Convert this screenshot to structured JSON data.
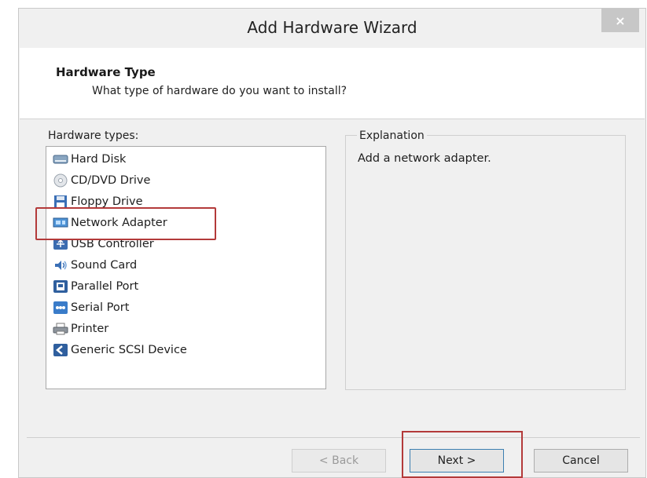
{
  "window": {
    "title": "Add Hardware Wizard",
    "close_label": "×"
  },
  "header": {
    "heading": "Hardware Type",
    "subheading": "What type of hardware do you want to install?"
  },
  "hardware_list": {
    "label": "Hardware types:",
    "selected": "Network Adapter",
    "items": [
      {
        "label": "Hard Disk",
        "icon": "hard-disk-icon"
      },
      {
        "label": "CD/DVD Drive",
        "icon": "cd-dvd-icon"
      },
      {
        "label": "Floppy Drive",
        "icon": "floppy-icon"
      },
      {
        "label": "Network Adapter",
        "icon": "network-adapter-icon"
      },
      {
        "label": "USB Controller",
        "icon": "usb-icon"
      },
      {
        "label": "Sound Card",
        "icon": "sound-card-icon"
      },
      {
        "label": "Parallel Port",
        "icon": "parallel-port-icon"
      },
      {
        "label": "Serial Port",
        "icon": "serial-port-icon"
      },
      {
        "label": "Printer",
        "icon": "printer-icon"
      },
      {
        "label": "Generic SCSI Device",
        "icon": "scsi-icon"
      }
    ]
  },
  "explanation": {
    "label": "Explanation",
    "text": "Add a network adapter."
  },
  "buttons": {
    "back": "< Back",
    "next": "Next >",
    "cancel": "Cancel"
  },
  "colors": {
    "highlight": "#b33a3a",
    "window_bg": "#f0f0f0",
    "icon_blue": "#3a6fb5"
  }
}
